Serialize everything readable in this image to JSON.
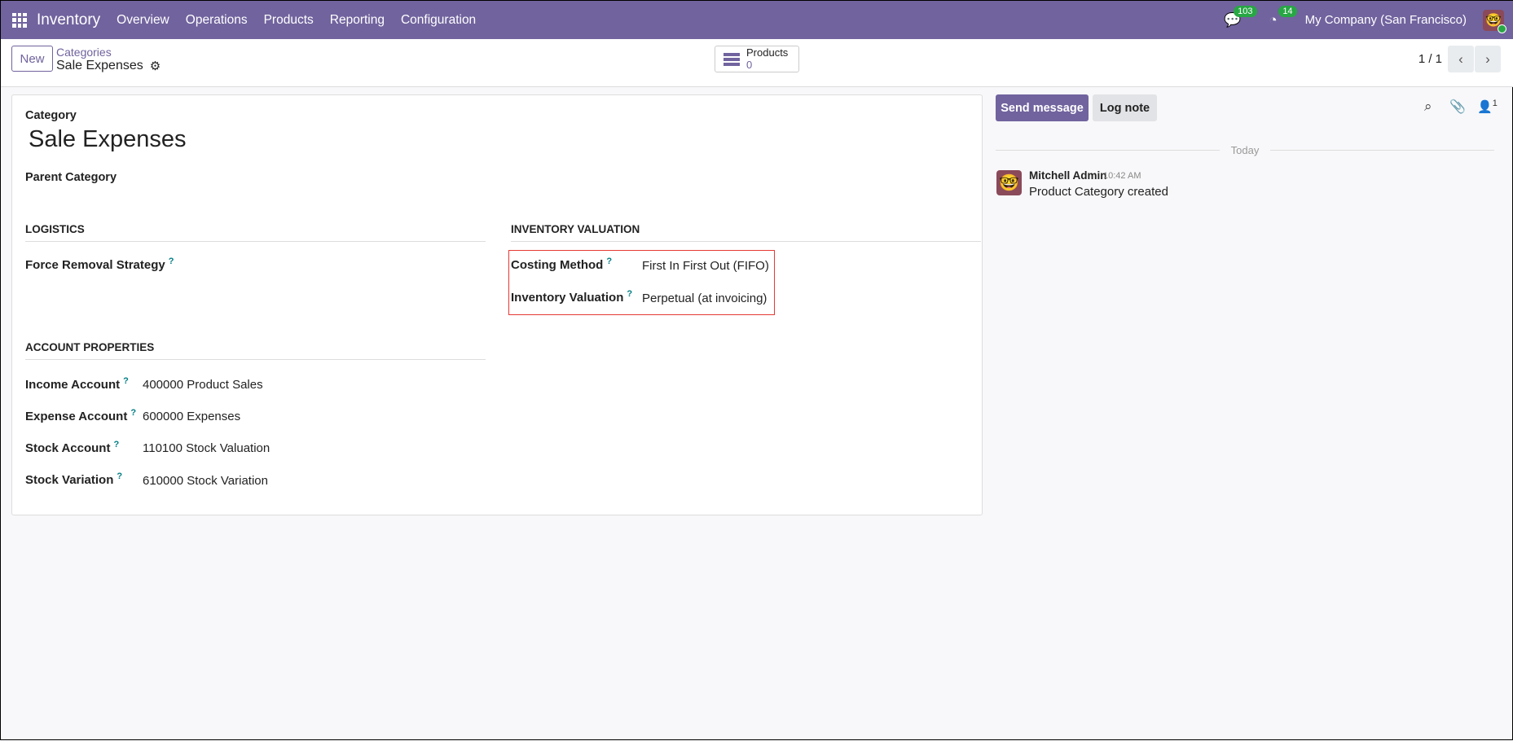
{
  "navbar": {
    "app": "Inventory",
    "menu": [
      "Overview",
      "Operations",
      "Products",
      "Reporting",
      "Configuration"
    ],
    "messages_count": "103",
    "activities_count": "14",
    "company": "My Company (San Francisco)"
  },
  "control_panel": {
    "new_label": "New",
    "breadcrumb_parent": "Categories",
    "breadcrumb_current": "Sale Expenses",
    "products_label": "Products",
    "products_count": "0",
    "pager": "1 / 1"
  },
  "form": {
    "category_label": "Category",
    "category_name": "Sale Expenses",
    "parent_label": "Parent Category",
    "logistics_title": "LOGISTICS",
    "force_removal_label": "Force Removal Strategy",
    "valuation_title": "INVENTORY VALUATION",
    "costing_label": "Costing Method",
    "costing_value": "First In First Out (FIFO)",
    "valuation_label": "Inventory Valuation",
    "valuation_value": "Perpetual (at invoicing)",
    "account_title": "ACCOUNT PROPERTIES",
    "accounts": [
      {
        "label": "Income Account",
        "value": "400000 Product Sales"
      },
      {
        "label": "Expense Account",
        "value": "600000 Expenses"
      },
      {
        "label": "Stock Account",
        "value": "110100 Stock Valuation"
      },
      {
        "label": "Stock Variation",
        "value": "610000 Stock Variation"
      }
    ],
    "help": "?"
  },
  "chatter": {
    "send_label": "Send message",
    "log_label": "Log note",
    "followers": "1",
    "today": "Today",
    "author": "Mitchell Admin",
    "time": "10:42 AM",
    "body": "Product Category created"
  }
}
